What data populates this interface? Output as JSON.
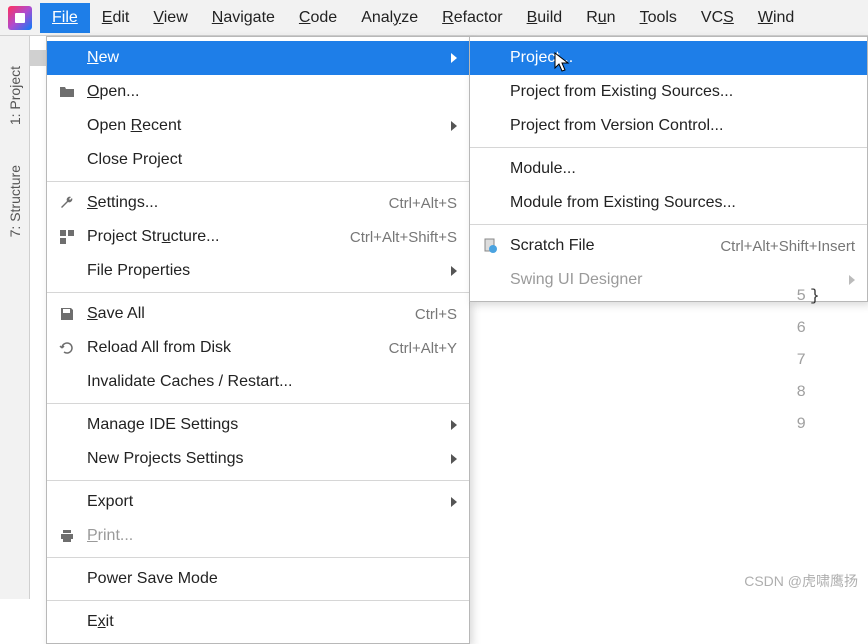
{
  "menubar": {
    "items": [
      {
        "label": "File",
        "underline": 0,
        "active": true
      },
      {
        "label": "Edit",
        "underline": 0
      },
      {
        "label": "View",
        "underline": 0
      },
      {
        "label": "Navigate",
        "underline": 0
      },
      {
        "label": "Code",
        "underline": 0
      },
      {
        "label": "Analyze",
        "underline": 4
      },
      {
        "label": "Refactor",
        "underline": 0
      },
      {
        "label": "Build",
        "underline": 0
      },
      {
        "label": "Run",
        "underline": 1
      },
      {
        "label": "Tools",
        "underline": 0
      },
      {
        "label": "VCS",
        "underline": 2
      },
      {
        "label": "Window",
        "underline": 0
      }
    ]
  },
  "file_menu": {
    "items": [
      {
        "label": "New",
        "underline": 0,
        "submenu": true,
        "highlighted": true
      },
      {
        "label": "Open...",
        "underline": 0,
        "icon": "folder"
      },
      {
        "label": "Open Recent",
        "underline": 5,
        "submenu": true
      },
      {
        "label": "Close Project"
      },
      {
        "sep": true
      },
      {
        "label": "Settings...",
        "underline": 0,
        "icon": "wrench",
        "shortcut": "Ctrl+Alt+S"
      },
      {
        "label": "Project Structure...",
        "underline": 8,
        "icon": "structure",
        "shortcut": "Ctrl+Alt+Shift+S"
      },
      {
        "label": "File Properties",
        "submenu": true
      },
      {
        "sep": true
      },
      {
        "label": "Save All",
        "underline": 0,
        "icon": "save",
        "shortcut": "Ctrl+S"
      },
      {
        "label": "Reload All from Disk",
        "icon": "reload",
        "shortcut": "Ctrl+Alt+Y"
      },
      {
        "label": "Invalidate Caches / Restart..."
      },
      {
        "sep": true
      },
      {
        "label": "Manage IDE Settings",
        "submenu": true
      },
      {
        "label": "New Projects Settings",
        "submenu": true
      },
      {
        "sep": true
      },
      {
        "label": "Export",
        "submenu": true
      },
      {
        "label": "Print...",
        "underline": 0,
        "icon": "print",
        "disabled": true
      },
      {
        "sep": true
      },
      {
        "label": "Power Save Mode"
      },
      {
        "sep": true
      },
      {
        "label": "Exit",
        "underline": 1
      }
    ]
  },
  "new_submenu": {
    "items": [
      {
        "label": "Project...",
        "highlighted": true
      },
      {
        "label": "Project from Existing Sources..."
      },
      {
        "label": "Project from Version Control..."
      },
      {
        "sep": true
      },
      {
        "label": "Module..."
      },
      {
        "label": "Module from Existing Sources..."
      },
      {
        "sep": true
      },
      {
        "label": "Scratch File",
        "icon": "scratch",
        "shortcut": "Ctrl+Alt+Shift+Insert"
      },
      {
        "label": "Swing UI Designer",
        "submenu": true,
        "disabled": true
      }
    ]
  },
  "sidebar": {
    "tabs": [
      {
        "label": "1: Project"
      },
      {
        "label": "7: Structure"
      }
    ]
  },
  "editor": {
    "line_numbers": [
      "5",
      "6",
      "7",
      "8",
      "9"
    ],
    "code_lines": [
      "",
      "",
      "",
      "}",
      ""
    ]
  },
  "watermark": "CSDN @虎啸鹰扬"
}
